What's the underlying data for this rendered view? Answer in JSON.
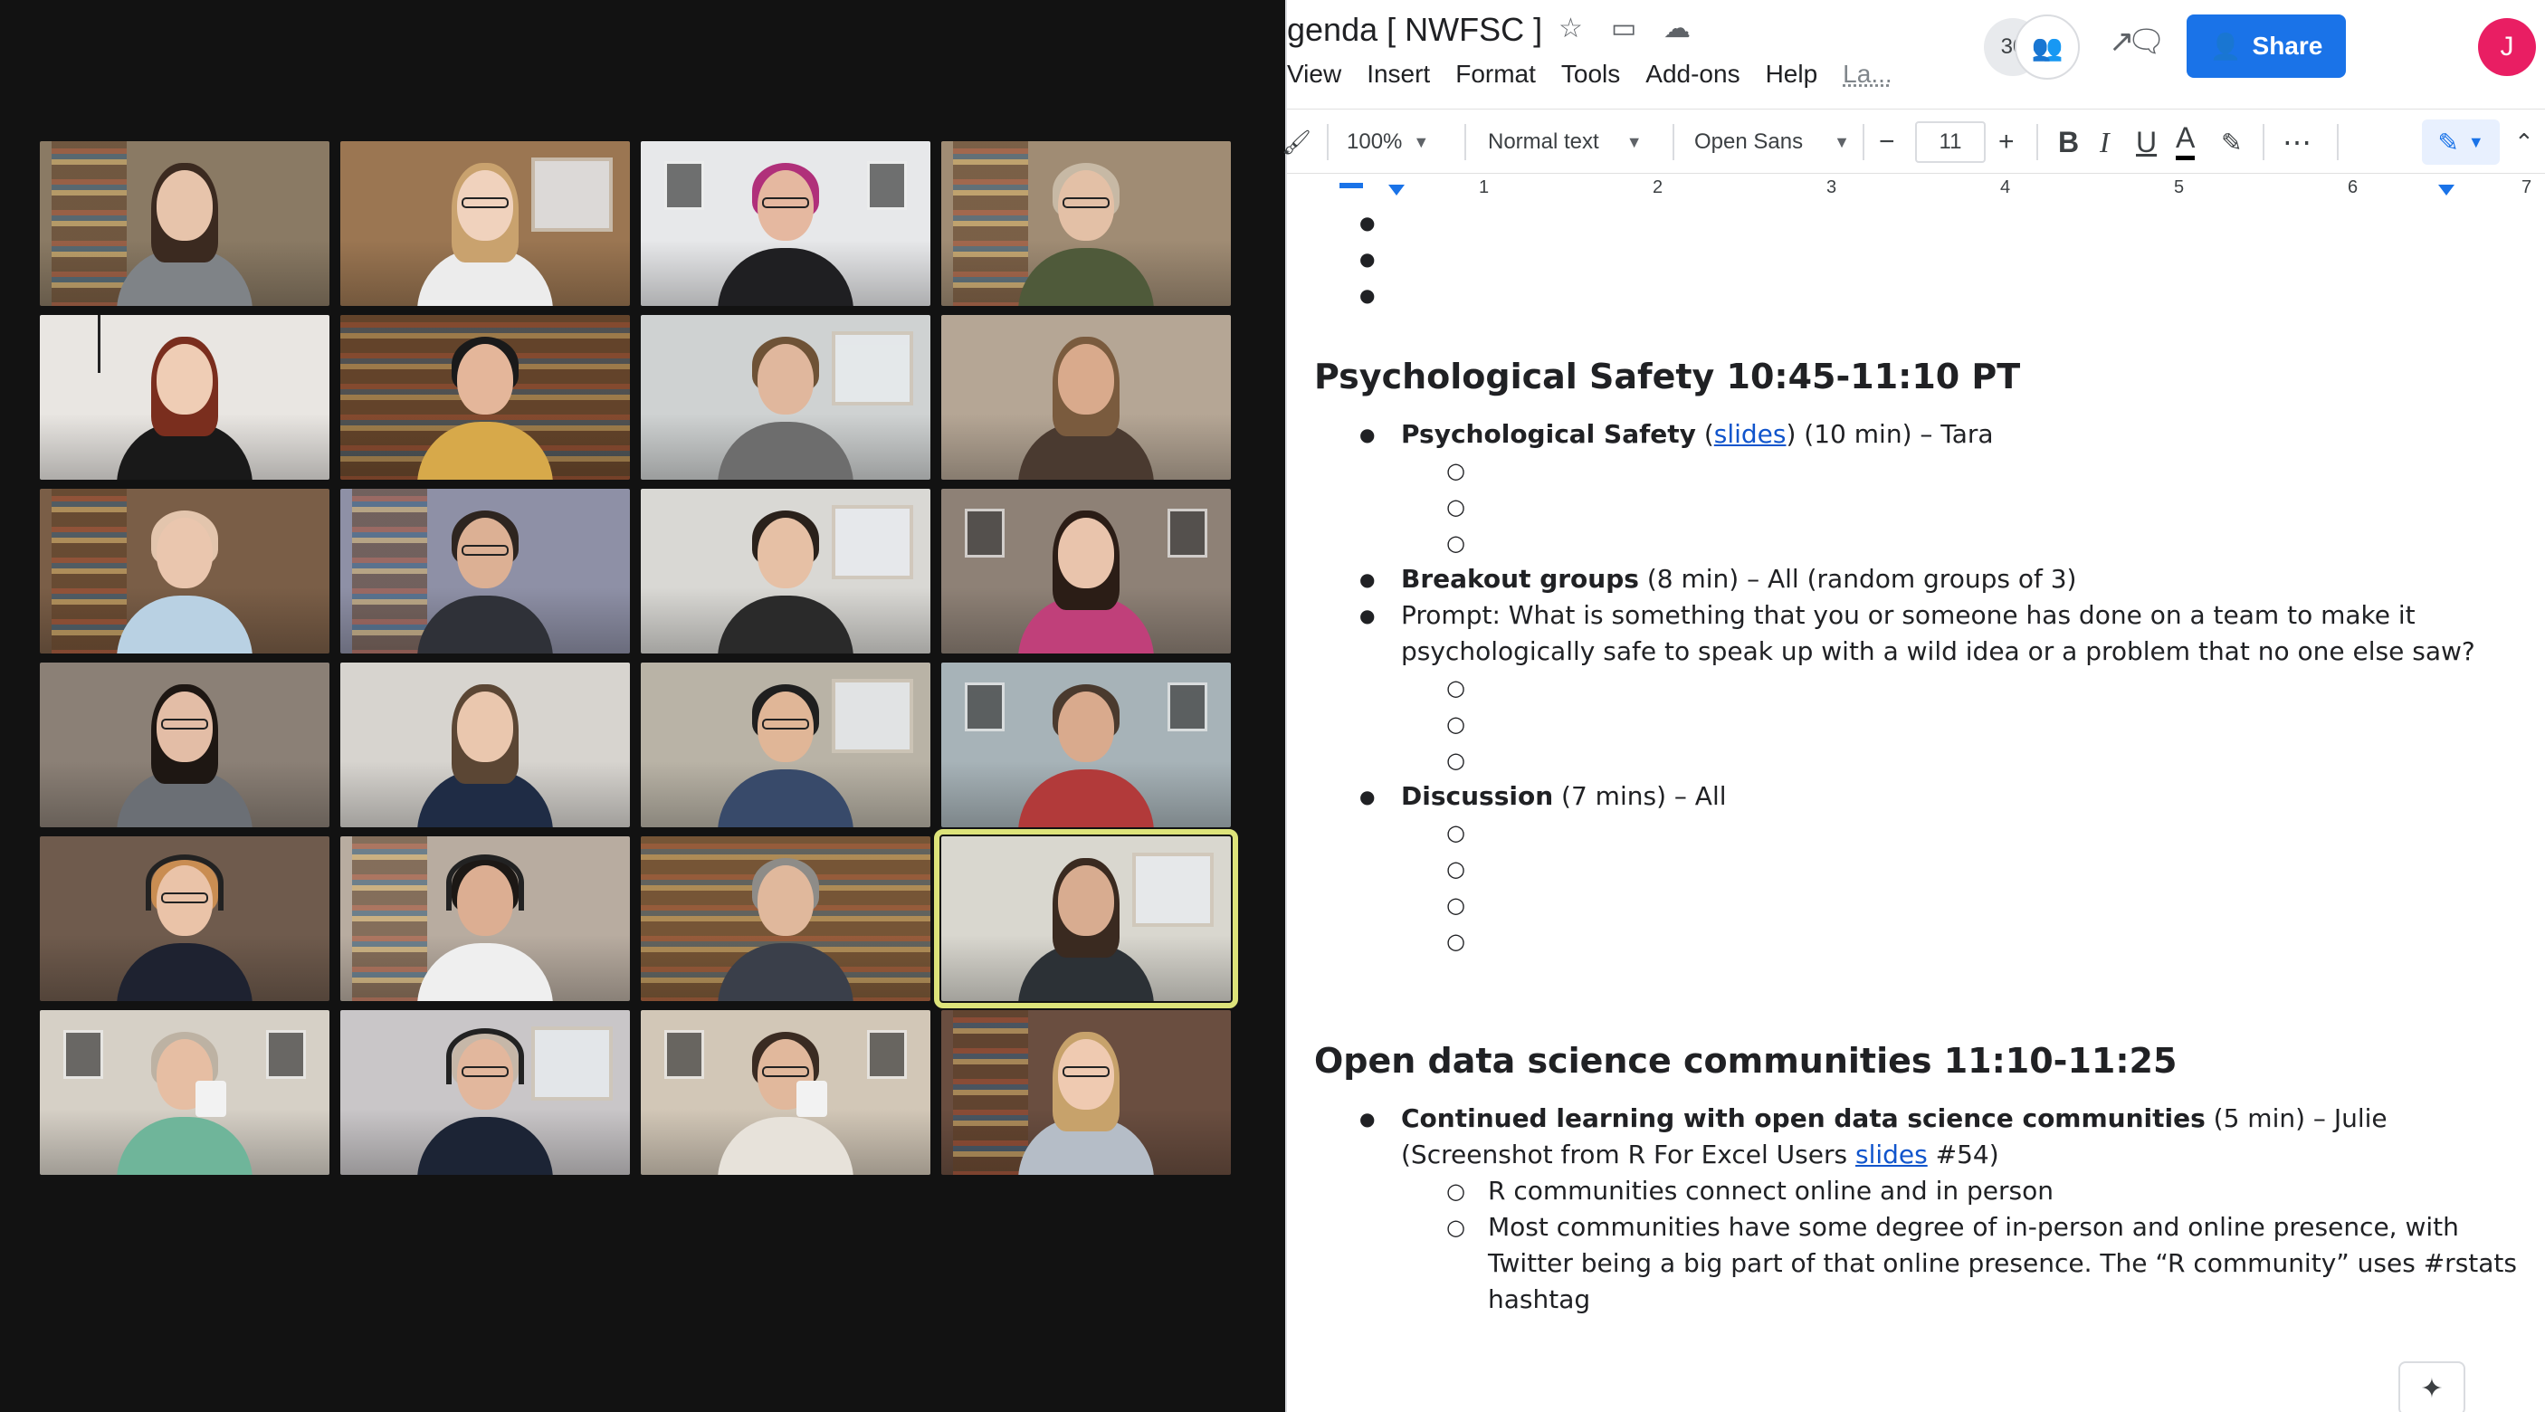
{
  "call": {
    "participants": [
      {
        "name": "participant-1",
        "bg": "#8a7a64",
        "skin": "#e7c4ab",
        "hair": "#3b2a20",
        "shirt": "#7f8387",
        "long": true,
        "glasses": false,
        "scene": "shelf"
      },
      {
        "name": "participant-2",
        "bg": "#9b7652",
        "skin": "#f0d2bd",
        "hair": "#c9a26e",
        "shirt": "#ececec",
        "long": true,
        "glasses": true,
        "scene": "window"
      },
      {
        "name": "participant-3",
        "bg": "#e7e8ea",
        "skin": "#e5b8a0",
        "hair": "#b0307a",
        "shirt": "#1f1f22",
        "long": false,
        "glasses": true,
        "scene": "art"
      },
      {
        "name": "participant-4",
        "bg": "#a08c74",
        "skin": "#e3c0a6",
        "hair": "#c7b9a5",
        "shirt": "#4f5a3a",
        "long": false,
        "glasses": true,
        "scene": "shelf"
      },
      {
        "name": "participant-5",
        "bg": "#e9e6e2",
        "skin": "#efcdb5",
        "hair": "#7a2e1e",
        "shirt": "#191919",
        "long": true,
        "glasses": false,
        "scene": "lamp"
      },
      {
        "name": "participant-6",
        "bg": "#6a4a30",
        "skin": "#e4b69a",
        "hair": "#1a1a1a",
        "shirt": "#d7a94a",
        "long": false,
        "glasses": false,
        "scene": "books"
      },
      {
        "name": "participant-7",
        "bg": "#cfd2d2",
        "skin": "#e0b79d",
        "hair": "#6e5236",
        "shirt": "#6d6d6d",
        "long": false,
        "glasses": false,
        "scene": "window"
      },
      {
        "name": "participant-8",
        "bg": "#b5a695",
        "skin": "#d9aa8c",
        "hair": "#7a5b3e",
        "shirt": "#4a3a30",
        "long": true,
        "glasses": false,
        "scene": "plain"
      },
      {
        "name": "participant-9",
        "bg": "#7a5e47",
        "skin": "#eac6ae",
        "hair": "#e3c5ad",
        "shirt": "#b9d1e3",
        "long": false,
        "glasses": false,
        "scene": "shelf"
      },
      {
        "name": "participant-10",
        "bg": "#8e90a6",
        "skin": "#dcb094",
        "hair": "#2e2520",
        "shirt": "#2f3138",
        "long": false,
        "glasses": true,
        "scene": "shelf"
      },
      {
        "name": "participant-11",
        "bg": "#d9d8d4",
        "skin": "#e6c0a5",
        "hair": "#2a211b",
        "shirt": "#2a2a2a",
        "long": false,
        "glasses": false,
        "scene": "window"
      },
      {
        "name": "participant-12",
        "bg": "#8e8176",
        "skin": "#e9c4ac",
        "hair": "#2b1d16",
        "shirt": "#c0407a",
        "long": true,
        "glasses": false,
        "scene": "art"
      },
      {
        "name": "participant-13",
        "bg": "#8b8076",
        "skin": "#e3bda6",
        "hair": "#1e1713",
        "shirt": "#6b6f75",
        "long": true,
        "glasses": true,
        "scene": "plain"
      },
      {
        "name": "participant-14",
        "bg": "#d7d4cf",
        "skin": "#eac7ae",
        "hair": "#5b4634",
        "shirt": "#1f2c45",
        "long": true,
        "glasses": false,
        "scene": "plain"
      },
      {
        "name": "participant-15",
        "bg": "#b9b3a6",
        "skin": "#e0b697",
        "hair": "#1f1f1f",
        "shirt": "#384a6a",
        "long": false,
        "glasses": true,
        "scene": "window"
      },
      {
        "name": "participant-16",
        "bg": "#a7b3b8",
        "skin": "#d9aa8d",
        "hair": "#4a3a2e",
        "shirt": "#b23a3a",
        "long": false,
        "glasses": false,
        "scene": "art"
      },
      {
        "name": "participant-17",
        "bg": "#6f5b4d",
        "skin": "#eac3a8",
        "hair": "#c98d52",
        "shirt": "#1e2230",
        "long": false,
        "glasses": true,
        "headset": true,
        "scene": "plain"
      },
      {
        "name": "participant-18",
        "bg": "#b8aca0",
        "skin": "#dcae92",
        "hair": "#1c1815",
        "shirt": "#efefef",
        "long": false,
        "glasses": false,
        "headset": true,
        "scene": "shelf"
      },
      {
        "name": "participant-19",
        "bg": "#8c6a46",
        "skin": "#e0b89c",
        "hair": "#8e8c88",
        "shirt": "#3a3f4a",
        "long": false,
        "glasses": false,
        "scene": "books"
      },
      {
        "name": "participant-20",
        "bg": "#d9d7cf",
        "skin": "#d8ac90",
        "hair": "#3a2a20",
        "shirt": "#2c3136",
        "long": true,
        "glasses": false,
        "scene": "window",
        "active": true
      },
      {
        "name": "participant-21",
        "bg": "#d6d0c6",
        "skin": "#e6bea3",
        "hair": "#bdb2a3",
        "shirt": "#6fb59a",
        "long": false,
        "glasses": false,
        "mug": true,
        "scene": "art"
      },
      {
        "name": "participant-22",
        "bg": "#c9c6c8",
        "skin": "#e2b79d",
        "hair": "#c6b7a8",
        "shirt": "#1c2435",
        "long": false,
        "glasses": true,
        "headset": true,
        "scene": "window"
      },
      {
        "name": "participant-23",
        "bg": "#d2c7b7",
        "skin": "#e1b89c",
        "hair": "#3a2b22",
        "shirt": "#e7e2da",
        "long": false,
        "glasses": true,
        "mug": true,
        "scene": "art"
      },
      {
        "name": "participant-24",
        "bg": "#6a4e40",
        "skin": "#efcab1",
        "hair": "#c7a26b",
        "shirt": "#b5bdc7",
        "long": true,
        "glasses": true,
        "scene": "shelf"
      }
    ]
  },
  "docs": {
    "title": "genda [ NWFSC ]",
    "menu": [
      "View",
      "Insert",
      "Format",
      "Tools",
      "Add-ons",
      "Help"
    ],
    "menu_last_edit": "La...",
    "viewer_count": "30",
    "share_label": "Share",
    "user_initial": "J",
    "toolbar": {
      "zoom": "100%",
      "style": "Normal text",
      "font": "Open Sans",
      "font_size": "11",
      "minus": "−",
      "plus": "+",
      "bold": "B",
      "italic": "I",
      "underline": "U",
      "text_color": "A",
      "more": "⋯"
    },
    "ruler": [
      "1",
      "2",
      "3",
      "4",
      "5",
      "6",
      "7"
    ],
    "section1": {
      "heading": "Psychological Safety 10:45-11:10 PT",
      "item1_bold": "Psychological Safety",
      "item1_link": "slides",
      "item1_rest": ") (10 min) – Tara",
      "item2_bold": "Breakout groups",
      "item2_rest": " (8 min) – All (random groups of 3)",
      "item3": "Prompt: What is something that you or someone has done on a team to make it psychologically safe to speak up with a wild idea or a problem that no one else saw?",
      "item4_bold": "Discussion",
      "item4_rest": " (7 mins) – All"
    },
    "section2": {
      "heading": "Open data science communities 11:10-11:25",
      "item1_bold": "Continued learning with open data science communities",
      "item1_rest": " (5 min) – Julie (Screenshot from R For Excel Users ",
      "item1_link": "slides",
      "item1_tail": " #54)",
      "sub1": "R communities connect online and in person",
      "sub2": "Most communities have some degree of in-person and online presence, with Twitter being a big part of that online presence. The “R community” uses #rstats hashtag"
    }
  }
}
